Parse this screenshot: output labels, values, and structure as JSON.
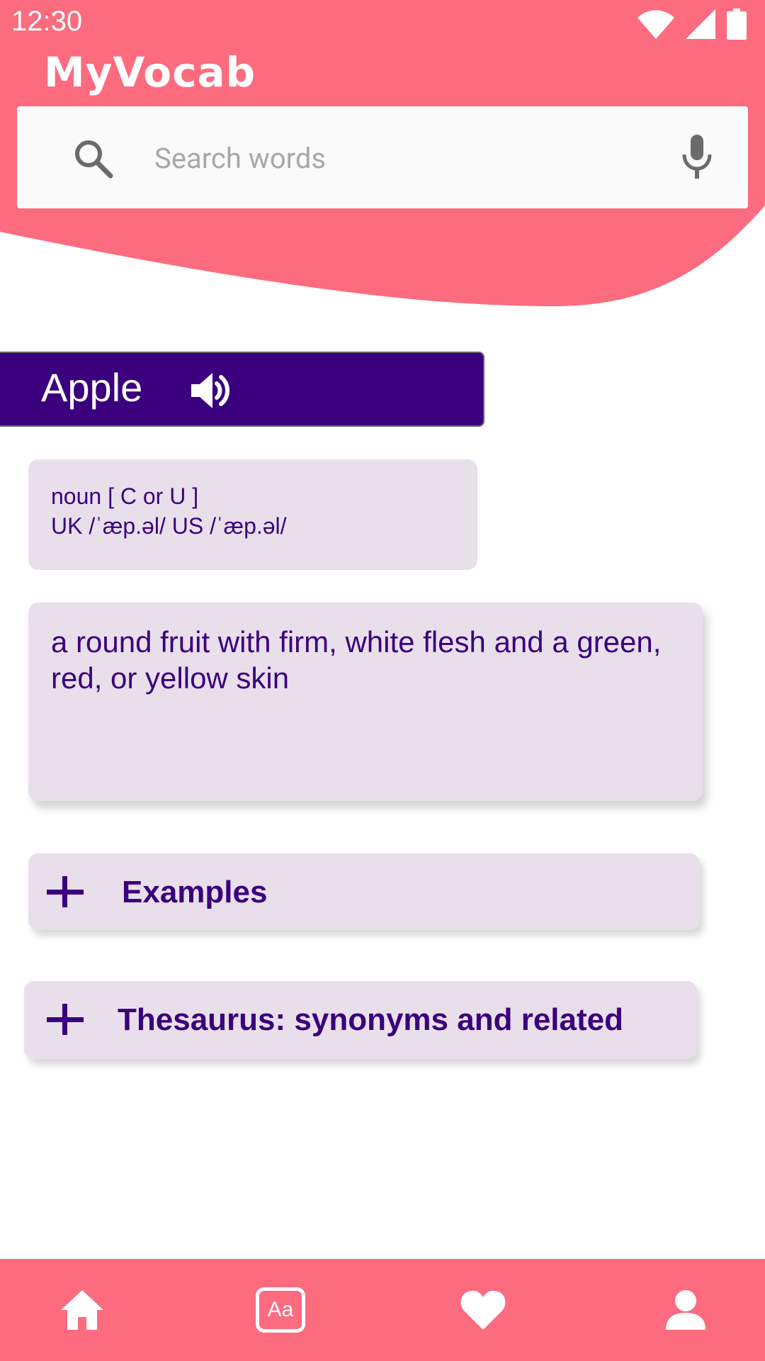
{
  "colors": {
    "header_pink": "#fc6b7e",
    "accent_purple": "#3b007d",
    "card_bg": "#e8dfeb",
    "search_bg": "#fafafa"
  },
  "status_bar": {
    "time": "12:30",
    "icons": [
      "wifi-icon",
      "cellular-signal-icon",
      "battery-icon"
    ]
  },
  "app": {
    "title": "MyVocab"
  },
  "search": {
    "placeholder": "Search words",
    "value": "",
    "left_icon": "search-icon",
    "right_icon": "microphone-icon"
  },
  "word": {
    "headword": "Apple",
    "audio_icon": "speaker-icon",
    "part_of_speech": "noun [ C or U ]",
    "pronunciation": "UK  /ˈæp.əl/ US /ˈæp.əl/",
    "definition": "a round fruit with firm, white flesh and a green, red, or yellow skin"
  },
  "sections": [
    {
      "icon": "plus-icon",
      "label": "Examples"
    },
    {
      "icon": "plus-icon",
      "label": "Thesaurus: synonyms and related"
    }
  ],
  "bottom_nav": {
    "items": [
      {
        "icon": "home-icon"
      },
      {
        "icon": "dictionary-icon",
        "text": "Aa"
      },
      {
        "icon": "heart-icon"
      },
      {
        "icon": "profile-icon"
      }
    ]
  }
}
